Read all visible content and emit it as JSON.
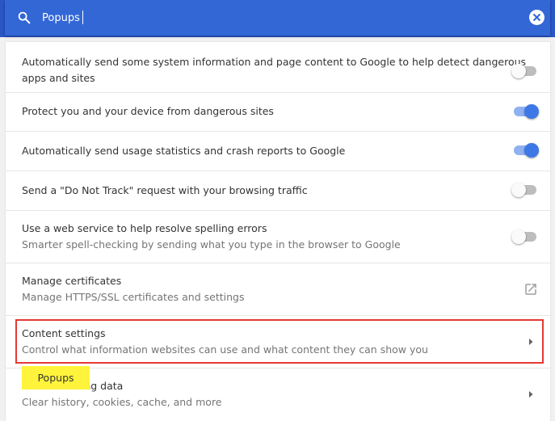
{
  "search": {
    "value": "Popups",
    "icon": "search-icon",
    "clear_icon": "close-icon"
  },
  "settings": [
    {
      "title": "Automatically send some system information and page content to Google to help detect dangerous",
      "title2": "apps and sites",
      "control": "toggle",
      "enabled": false
    },
    {
      "title": "Protect you and your device from dangerous sites",
      "control": "toggle",
      "enabled": true
    },
    {
      "title": "Automatically send usage statistics and crash reports to Google",
      "control": "toggle",
      "enabled": true
    },
    {
      "title": "Send a \"Do Not Track\" request with your browsing traffic",
      "control": "toggle",
      "enabled": false
    },
    {
      "title": "Use a web service to help resolve spelling errors",
      "subtitle": "Smarter spell-checking by sending what you type in the browser to Google",
      "control": "toggle",
      "enabled": false
    },
    {
      "title": "Manage certificates",
      "subtitle": "Manage HTTPS/SSL certificates and settings",
      "control": "external-link-icon"
    },
    {
      "title": "Content settings",
      "subtitle": "Control what information websites can use and what content they can show you",
      "control": "chevron-right-icon",
      "highlighted": true
    },
    {
      "title": "Clear browsing data",
      "subtitle": "Clear history, cookies, cache, and more",
      "control": "chevron-right-icon"
    }
  ],
  "search_bubble": {
    "label": "Popups"
  },
  "colors": {
    "header": "#3367d6",
    "toggle_on": "#3e78e6",
    "highlight_border": "#e53935",
    "bubble": "#fff33b"
  }
}
